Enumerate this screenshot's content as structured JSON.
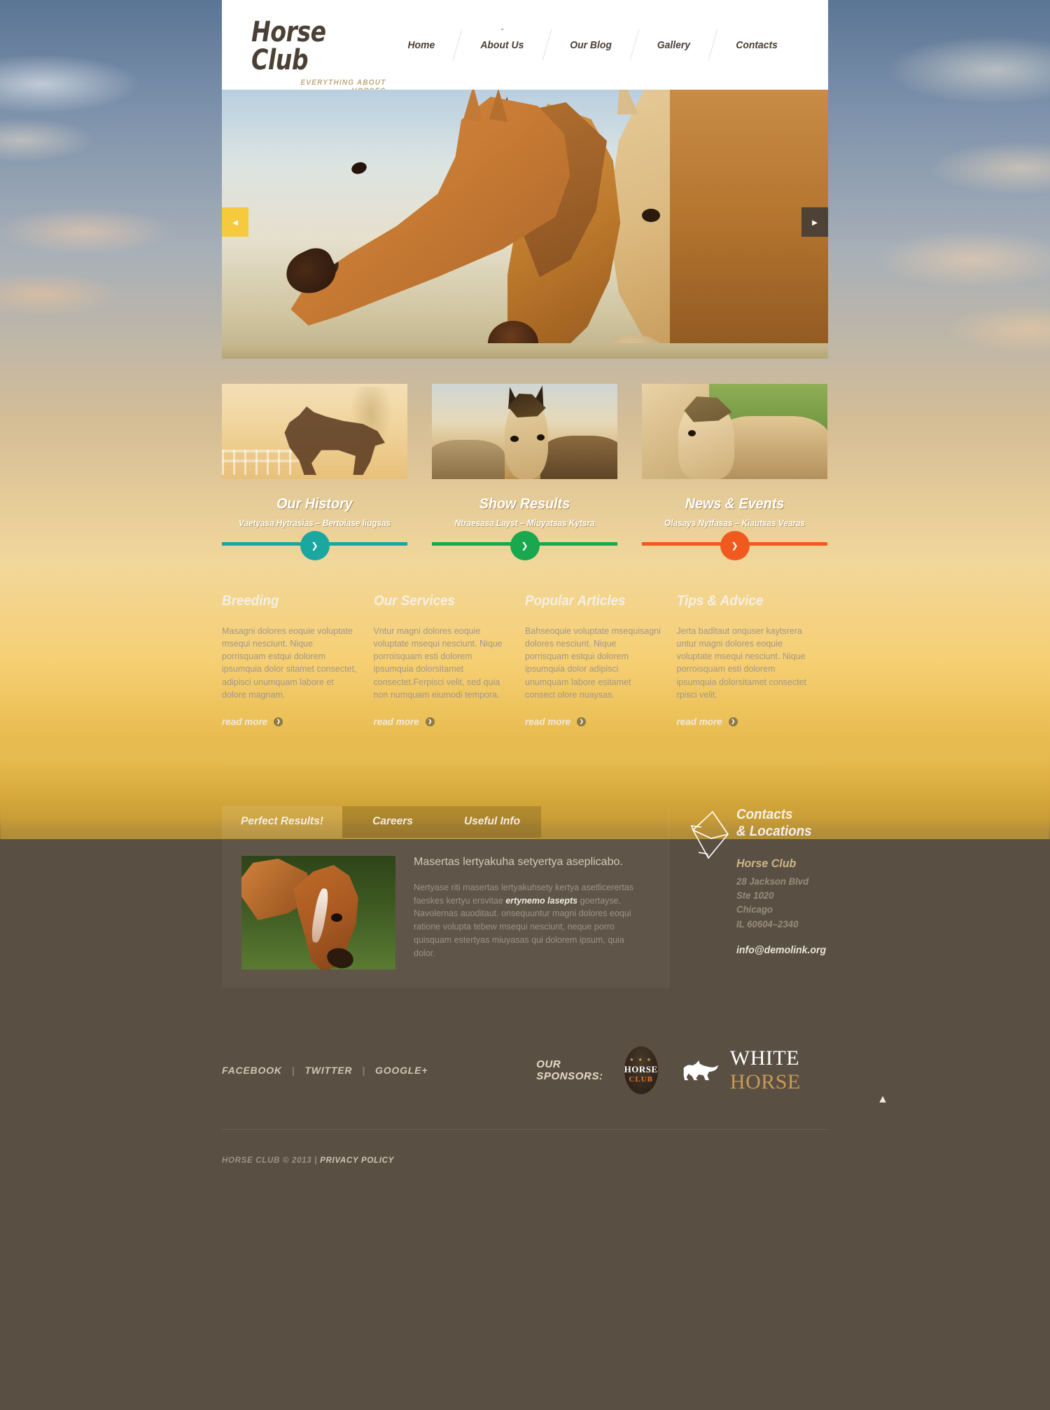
{
  "brand": {
    "title": "Horse Club",
    "tagline": "EVERYTHING ABOUT HORSES"
  },
  "nav": [
    {
      "label": "Home",
      "has_caret": false
    },
    {
      "label": "About Us",
      "has_caret": true
    },
    {
      "label": "Our Blog",
      "has_caret": false
    },
    {
      "label": "Gallery",
      "has_caret": false
    },
    {
      "label": "Contacts",
      "has_caret": false
    }
  ],
  "slider": {
    "prev_icon": "◄",
    "next_icon": "►"
  },
  "cards": [
    {
      "title": "Our History",
      "subtitle": "Vaetyasa Hytrasias – Bertoiase liugsas",
      "color": "#1ba7a0",
      "btn_icon": "❯"
    },
    {
      "title": "Show Results",
      "subtitle": "Ntraesasa Layst – Miuyatsas Kytsra",
      "color": "#19a84e",
      "btn_icon": "❯"
    },
    {
      "title": "News & Events",
      "subtitle": "Olasays Nytfasas – Kiautsas Vearas",
      "color": "#f05a1e",
      "btn_icon": "❯"
    }
  ],
  "columns": [
    {
      "title": "Breeding",
      "text": "Masagni dolores eoquie voluptate msequi nesciunt. Nique porrisquam estqui dolorem ipsumquia dolor sitamet consectet, adipisci unumquam labore et dolore magnam.",
      "read_more": "read more",
      "read_more_icon": "❯"
    },
    {
      "title": "Our Services",
      "text": "Vntur magni dolores eoquie voluptate msequi nesciunt. Nique porroisquam esti dolorem ipsumquia dolorsitamet consectet.Ferpisci velit, sed quia non numquam eiumodi tempora.",
      "read_more": "read more",
      "read_more_icon": "❯"
    },
    {
      "title": "Popular Articles",
      "text": "Bahseoquie voluptate msequisagni dolores nesciunt. Nique porrisquam estqui dolorem ipsumquia dolor adipisci unumquam labore esitamet consect olore nuaysas.",
      "read_more": "read more",
      "read_more_icon": "❯"
    },
    {
      "title": "Tips & Advice",
      "text": "Jerta baditaut onquser kaytsrera untur magni dolores eoquie voluptate msequi nesciunt. Nique porroisquam esti dolorem ipsumquia dolorsitamet consectet rpisci velit.",
      "read_more": "read more",
      "read_more_icon": "❯"
    }
  ],
  "tabs": {
    "items": [
      {
        "label": "Perfect Results!",
        "active": true
      },
      {
        "label": "Careers",
        "active": false
      },
      {
        "label": "Useful Info",
        "active": false
      }
    ],
    "panel": {
      "heading": "Masertas lertyakuha setyertya aseplicabo.",
      "text_before": "Nertyase riti masertas lertyakuhsety kertya asetlicerertas faeskes kertyu ersvitae ",
      "text_emphasis": "ertynemo lasepts",
      "text_after": " goertayse. Navolernas auoditaut. onsequuntur magni dolores eoqui ratione volupta tebew msequi nesciunt, neque porro quisquam estertyas miuyasas qui dolorem ipsum, quia dolor."
    }
  },
  "contacts": {
    "title_line1": "Contacts",
    "title_line2": "& Locations",
    "name": "Horse Club",
    "address": "28 Jackson Blvd\nSte 1020\nChicago\nIL 60604–2340",
    "email": "info@demolink.org"
  },
  "footer": {
    "social": [
      "FACEBOOK",
      "TWITTER",
      "GOOGLE+"
    ],
    "separator": "|",
    "sponsors_label": "OUR SPONSORS:",
    "sponsor_badge": {
      "stars": "★ ★ ★",
      "line1": "HORSE",
      "line2": "CLUB"
    },
    "sponsor_white": {
      "word1": "WHITE",
      "word2": "HORSE"
    },
    "copyright": "HORSE CLUB © 2013",
    "privacy": "PRIVACY POLICY",
    "to_top_icon": "▲"
  }
}
